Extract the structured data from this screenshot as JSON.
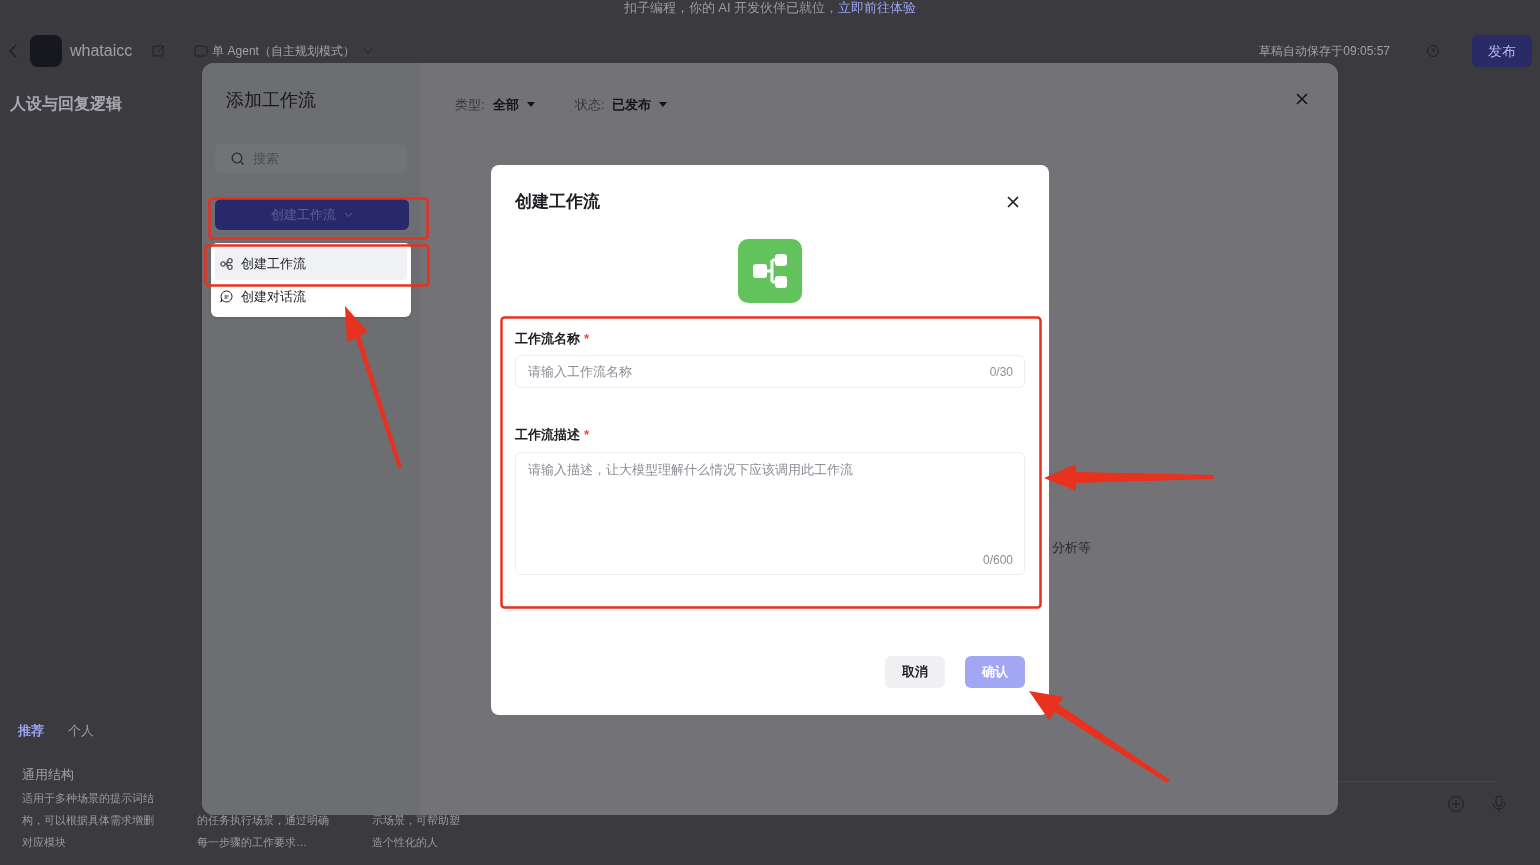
{
  "banner": {
    "text": "扣子编程，你的 AI 开发伙伴已就位，",
    "link": "立即前往体验"
  },
  "header": {
    "app_name": "whataicc",
    "mode": "单 Agent（自主规划模式）",
    "autosave": "草稿自动保存于09:05:57",
    "publish": "发布"
  },
  "persona": {
    "title": "人设与回复逻辑"
  },
  "template_tabs": [
    {
      "label": "推荐",
      "selected": true
    },
    {
      "label": "个人",
      "selected": false
    }
  ],
  "template_cards": [
    {
      "title": "通用结构",
      "description": "适用于多种场景的提示词结构，可以根据具体需求增删对应模块"
    },
    {
      "description": "的任务执行场景，通过明确每一步骤的工作要求…"
    },
    {
      "description": "示场景，可帮助塑造个性化的人"
    }
  ],
  "add_workflow_dialog": {
    "title": "添加工作流",
    "filters": [
      {
        "label": "类型:",
        "value": "全部"
      },
      {
        "label": "状态:",
        "value": "已发布"
      }
    ],
    "search": {
      "placeholder": "搜索"
    },
    "create_button": "创建工作流",
    "menu": [
      {
        "label": "创建工作流",
        "kind": "workflow",
        "selected": true
      },
      {
        "label": "创建对话流",
        "kind": "chatflow",
        "selected": false
      }
    ],
    "partial_text": "分析等"
  },
  "create_dialog": {
    "title": "创建工作流",
    "fields": [
      {
        "label": "工作流名称",
        "required_mark": "*",
        "kind": "input",
        "placeholder": "请输入工作流名称",
        "counter": "0/30"
      },
      {
        "label": "工作流描述",
        "required_mark": "*",
        "kind": "textarea",
        "placeholder": "请输入描述，让大模型理解什么情况下应该调用此工作流",
        "counter": "0/600"
      }
    ],
    "buttons": [
      {
        "label": "取消",
        "kind": "cancel",
        "disabled": false
      },
      {
        "label": "确认",
        "kind": "confirm",
        "disabled": true
      }
    ]
  }
}
